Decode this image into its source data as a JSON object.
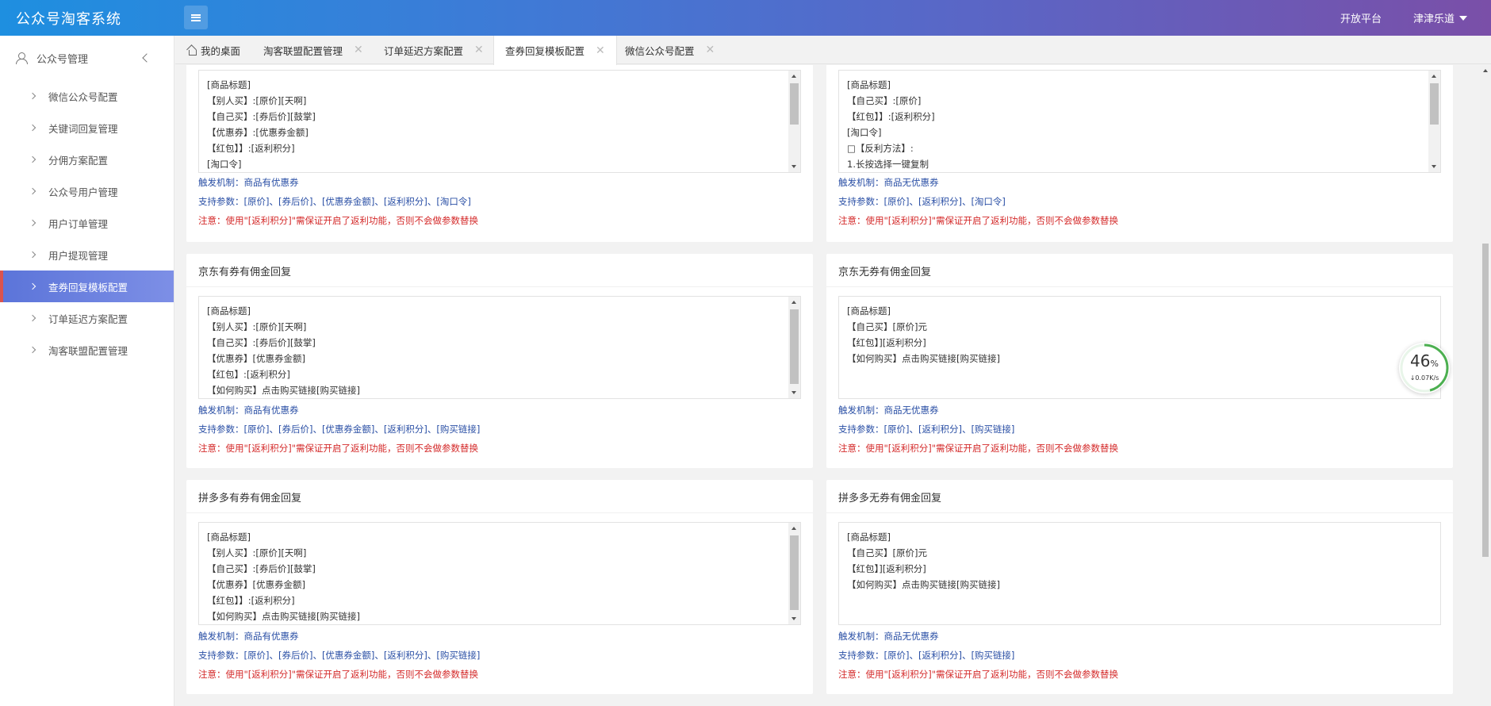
{
  "header": {
    "logo": "公众号淘客系统",
    "open_platform": "开放平台",
    "username": "津津乐道"
  },
  "sidebar": {
    "group_label": "公众号管理",
    "items": [
      {
        "label": "微信公众号配置"
      },
      {
        "label": "关键词回复管理"
      },
      {
        "label": "分佣方案配置"
      },
      {
        "label": "公众号用户管理"
      },
      {
        "label": "用户订单管理"
      },
      {
        "label": "用户提现管理"
      },
      {
        "label": "查券回复模板配置"
      },
      {
        "label": "订单延迟方案配置"
      },
      {
        "label": "淘客联盟配置管理"
      }
    ]
  },
  "tabs": [
    {
      "label": "我的桌面"
    },
    {
      "label": "淘客联盟配置管理"
    },
    {
      "label": "订单延迟方案配置"
    },
    {
      "label": "查券回复模板配置"
    },
    {
      "label": "微信公众号配置"
    }
  ],
  "cards": [
    {
      "title": "",
      "lines": [
        "[商品标题]",
        "【别人买】:[原价][天啊]",
        "【自己买】:[券后价][鼓掌]",
        "【优惠券】:[优惠券金额]",
        "【红包】】:[返利积分]",
        "[淘口令]"
      ],
      "trigger": "触发机制：商品有优惠券",
      "params": "支持参数：[原价]、[券后价]、[优惠券金额]、[返利积分]、[淘口令]",
      "warn": "注意：使用\"[返利积分]\"需保证开启了返利功能，否则不会做参数替换"
    },
    {
      "title": "",
      "lines": [
        "[商品标题]",
        "【自己买】:[原价]",
        "【红包】】:[返利积分]",
        "[淘口令]",
        "□【反利方法】:",
        "1.长按选择一键复制"
      ],
      "trigger": "触发机制：商品无优惠券",
      "params": "支持参数：[原价]、[返利积分]、[淘口令]",
      "warn": "注意：使用\"[返利积分]\"需保证开启了返利功能，否则不会做参数替换"
    },
    {
      "title": "京东有券有佣金回复",
      "lines": [
        "[商品标题]",
        "【别人买】:[原价][天啊]",
        "【自己买】:[券后价][鼓掌]",
        "【优惠券】[优惠券金额]",
        "【红包】:[返利积分]",
        "【如何购买】点击购买链接[购买链接]"
      ],
      "trigger": "触发机制：商品有优惠券",
      "params": "支持参数：[原价]、[券后价]、[优惠券金额]、[返利积分]、[购买链接]",
      "warn": "注意：使用\"[返利积分]\"需保证开启了返利功能，否则不会做参数替换"
    },
    {
      "title": "京东无券有佣金回复",
      "lines": [
        "[商品标题]",
        "【自己买】[原价]元",
        "【红包】][返利积分]",
        "【如何购买】点击购买链接[购买链接]"
      ],
      "trigger": "触发机制：商品无优惠券",
      "params": "支持参数：[原价]、[返利积分]、[购买链接]",
      "warn": "注意：使用\"[返利积分]\"需保证开启了返利功能，否则不会做参数替换"
    },
    {
      "title": "拼多多有券有佣金回复",
      "lines": [
        "[商品标题]",
        "【别人买】:[原价][天啊]",
        "【自己买】:[券后价][鼓掌]",
        "【优惠券】[优惠券金额]",
        "【红包】】:[返利积分]",
        "【如何购买】点击购买链接[购买链接]"
      ],
      "trigger": "触发机制：商品有优惠券",
      "params": "支持参数：[原价]、[券后价]、[优惠券金额]、[返利积分]、[购买链接]",
      "warn": "注意：使用\"[返利积分]\"需保证开启了返利功能，否则不会做参数替换"
    },
    {
      "title": "拼多多无券有佣金回复",
      "lines": [
        "[商品标题]",
        "【自己买】[原价]元",
        "【红包】][返利积分]",
        "【如何购买】点击购买链接[购买链接]"
      ],
      "trigger": "触发机制：商品无优惠券",
      "params": "支持参数：[原价]、[返利积分]、[购买链接]",
      "warn": "注意：使用\"[返利积分]\"需保证开启了返利功能，否则不会做参数替换"
    }
  ],
  "speed_widget": {
    "percent": "46",
    "percent_unit": "%",
    "rate": "↓0.07K/s",
    "level": 0.46
  },
  "colors": {
    "accent": "#5b74d9",
    "warn": "#d42a2a",
    "link": "#2a4fa5",
    "speed_ring": "#4caf50"
  }
}
